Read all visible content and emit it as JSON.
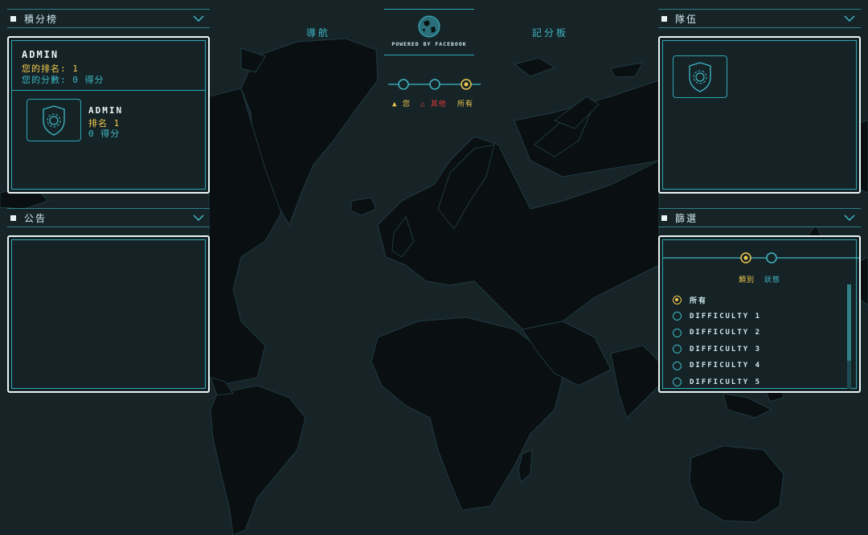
{
  "leaderboard": {
    "header": "積分榜",
    "user_name": "ADMIN",
    "your_rank": "您的排名: 1",
    "your_score": "您的分數: 0  得分",
    "entry_name": "ADMIN",
    "entry_rank": "排名 1",
    "entry_score": "0 得分"
  },
  "announcements": {
    "header": "公告"
  },
  "teams": {
    "header": "隊伍"
  },
  "filter": {
    "header": "篩選",
    "tabs": [
      "類別",
      "狀態"
    ],
    "options": [
      "所有",
      "DIFFICULTY 1",
      "DIFFICULTY 2",
      "DIFFICULTY 3",
      "DIFFICULTY 4",
      "DIFFICULTY 5"
    ],
    "selected": "所有"
  },
  "nav": {
    "navigation": "導航",
    "scoreboard": "記分板",
    "powered_by": "POWERED BY FACEBOOK"
  },
  "view_legend": {
    "you": "您",
    "others": "其他",
    "all": "所有"
  },
  "colors": {
    "background": "#162428",
    "land": "#0a0f11",
    "accent": "#3fb7c4",
    "highlight": "#f2c94c",
    "alert": "#e03a3a",
    "frame": "#e8f4f5"
  }
}
